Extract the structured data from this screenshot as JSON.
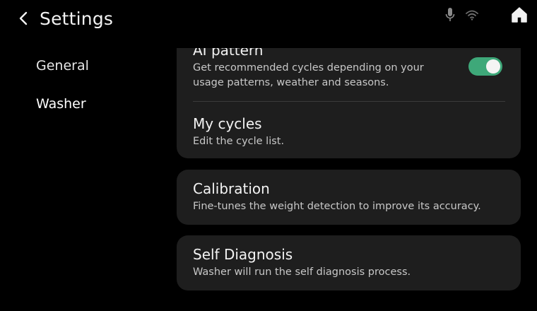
{
  "header": {
    "title": "Settings"
  },
  "status": {
    "icons": [
      "microphone-icon",
      "wifi-icon",
      "home-icon"
    ]
  },
  "nav": {
    "items": [
      {
        "label": "General"
      },
      {
        "label": "Washer"
      }
    ],
    "selected": "Washer"
  },
  "settings": {
    "ai_pattern": {
      "title": "AI pattern",
      "description": "Get recommended cycles depending on your usage patterns, weather and seasons.",
      "toggle_on": true
    },
    "my_cycles": {
      "title": "My cycles",
      "description": "Edit the cycle list."
    },
    "calibration": {
      "title": "Calibration",
      "description": "Fine-tunes the weight detection to improve its accuracy."
    },
    "self_diagnosis": {
      "title": "Self Diagnosis",
      "description": "Washer will run the self diagnosis process."
    }
  },
  "colors": {
    "background": "#000000",
    "card": "#1e1e1e",
    "toggle_on": "#3ea879",
    "text_primary": "#f3f3f3",
    "text_secondary": "#c8c8c8"
  }
}
